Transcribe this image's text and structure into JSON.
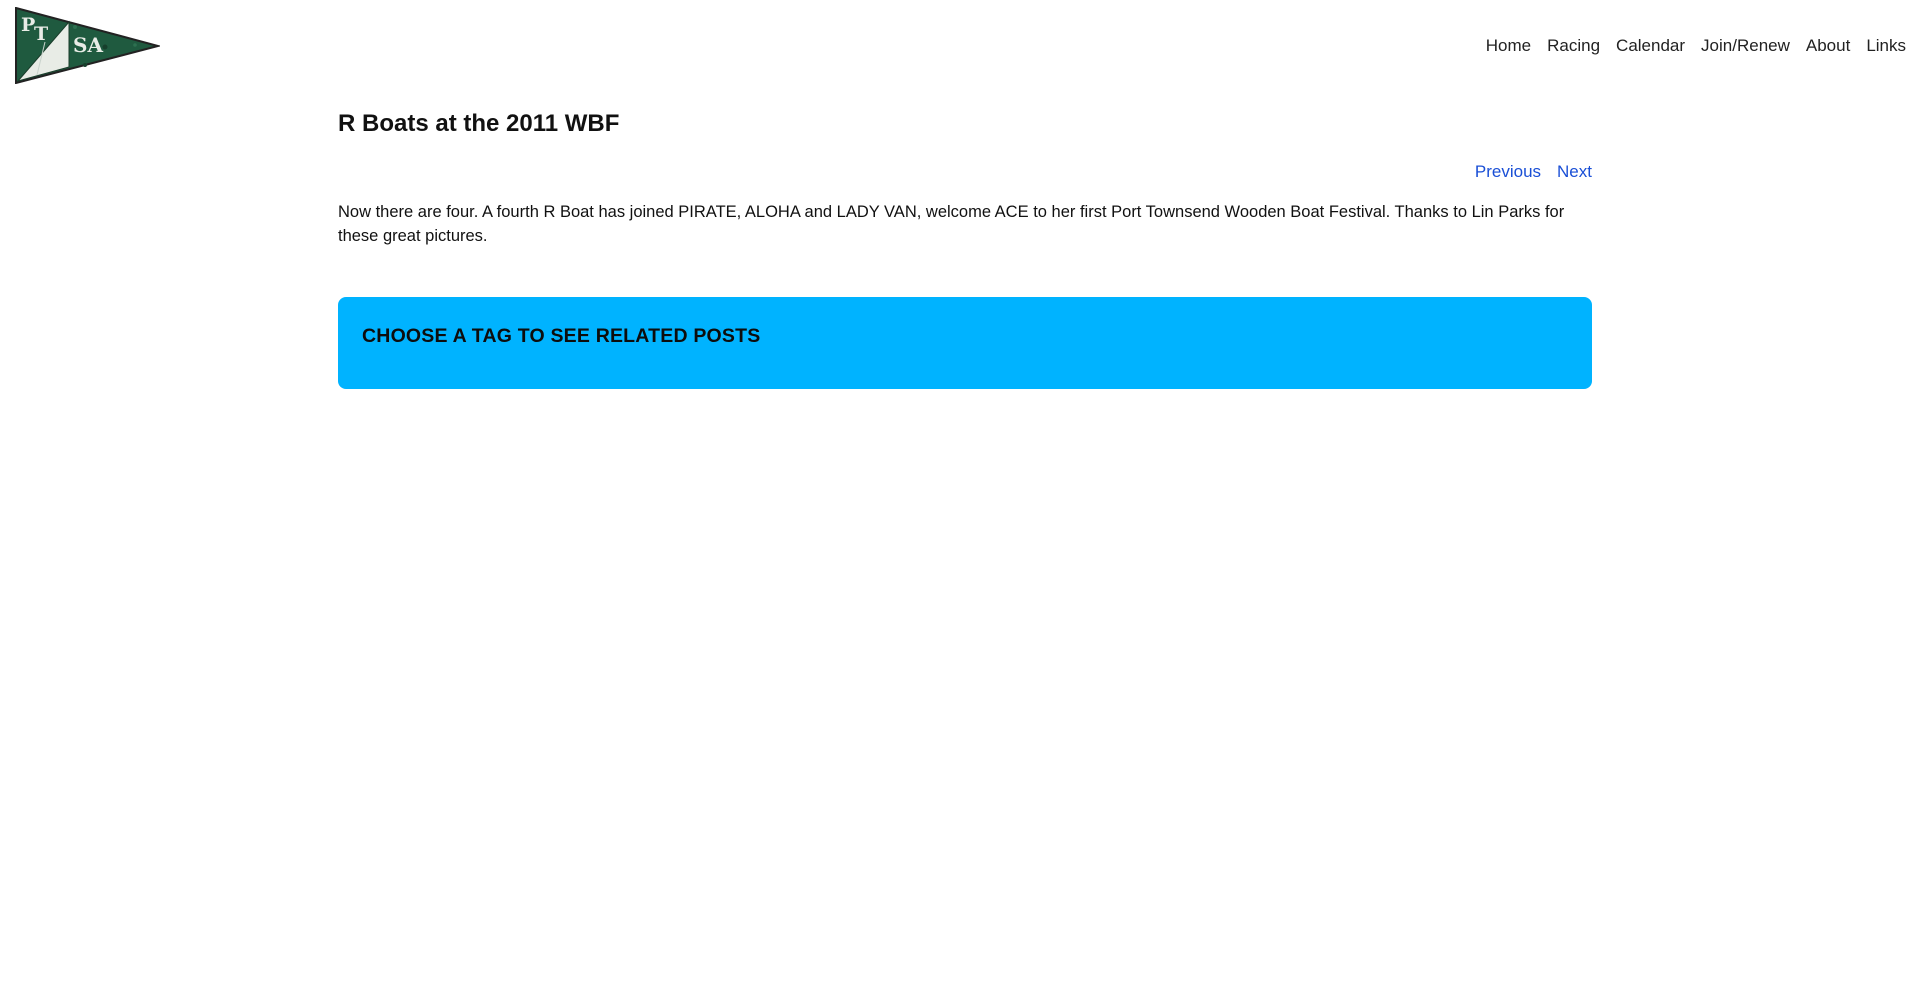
{
  "header": {
    "logo": {
      "icon": "ptsa-pennant-logo",
      "letters": [
        "P",
        "T",
        "SA"
      ],
      "colors": {
        "flag": "#1f5a3f",
        "sail": "#e8ece6",
        "outline": "#222222"
      }
    },
    "nav": [
      {
        "label": "Home"
      },
      {
        "label": "Racing"
      },
      {
        "label": "Calendar"
      },
      {
        "label": "Join/Renew"
      },
      {
        "label": "About"
      },
      {
        "label": "Links"
      }
    ]
  },
  "post": {
    "title": "R Boats at the 2011 WBF",
    "previous_label": "Previous",
    "next_label": "Next",
    "body": "Now there are four. A fourth R Boat has joined PIRATE, ALOHA and LADY VAN, welcome ACE to her first Port Townsend Wooden Boat Festival. Thanks to Lin Parks for these great pictures."
  },
  "tags": {
    "heading": "CHOOSE A TAG TO SEE RELATED POSTS"
  },
  "colors": {
    "link": "#1a4fd6",
    "tags_box": "#00b3ff",
    "nav_text": "#222222"
  }
}
